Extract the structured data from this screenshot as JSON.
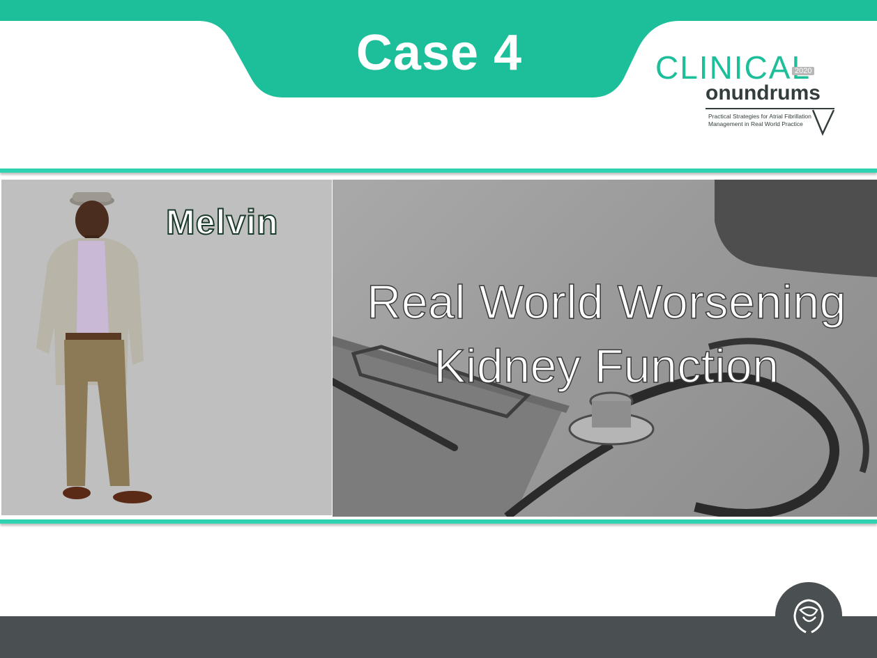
{
  "header": {
    "title": "Case 4"
  },
  "logo": {
    "line1": "CLINICAL",
    "year": "2020",
    "line2": "onundrums",
    "tagline_line1": "Practical Strategies for Atrial Fibrillation",
    "tagline_line2": "Management in Real World Practice"
  },
  "patient": {
    "name": "Melvin"
  },
  "slide": {
    "title_line1": "Real World Worsening",
    "title_line2": "Kidney Function"
  },
  "colors": {
    "accent": "#1dbf9a",
    "rule": "#2fd3b0",
    "footer": "#4a4f52",
    "panel_gray": "#bfbfbf"
  },
  "icons": {
    "footer_badge": "organization-emblem-icon",
    "background": "stethoscope-clipboard-photo"
  }
}
